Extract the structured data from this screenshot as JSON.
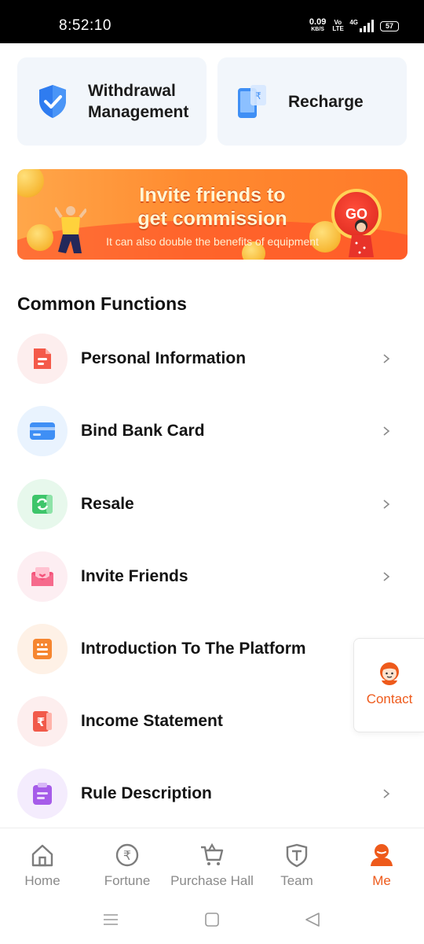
{
  "status_bar": {
    "time": "8:52:10",
    "speed_value": "0.09",
    "speed_unit": "KB/S",
    "volte": "Vo LTE",
    "network": "4G",
    "battery": "57"
  },
  "quick_actions": {
    "withdrawal_line1": "Withdrawal",
    "withdrawal_line2": "Management",
    "recharge": "Recharge"
  },
  "banner": {
    "title_line1": "Invite friends to",
    "title_line2": "get commission",
    "subtitle": "It can also double the benefits of equipment",
    "go_label": "GO"
  },
  "common_functions": {
    "title": "Common Functions",
    "items": [
      {
        "label": "Personal Information",
        "icon": "document-icon",
        "color": "#f45a4a",
        "bg": "#fdeeee"
      },
      {
        "label": "Bind Bank Card",
        "icon": "bank-card-icon",
        "color": "#3f8ff5",
        "bg": "#e9f3fe"
      },
      {
        "label": "Resale",
        "icon": "resale-icon",
        "color": "#3dc56a",
        "bg": "#e7f8ec"
      },
      {
        "label": "Invite Friends",
        "icon": "envelope-heart-icon",
        "color": "#f4537a",
        "bg": "#fdeef2"
      },
      {
        "label": "Introduction To The Platform",
        "icon": "list-doc-icon",
        "color": "#f68630",
        "bg": "#fef1e6"
      },
      {
        "label": "Income Statement",
        "icon": "rupee-doc-icon",
        "color": "#f15a4a",
        "bg": "#fdeeee"
      },
      {
        "label": "Rule Description",
        "icon": "clipboard-icon",
        "color": "#a65ce9",
        "bg": "#f4ecfd"
      }
    ]
  },
  "contact": {
    "label": "Contact"
  },
  "bottom_nav": {
    "items": [
      {
        "label": "Home",
        "icon": "home-icon"
      },
      {
        "label": "Fortune",
        "icon": "rupee-circle-icon"
      },
      {
        "label": "Purchase Hall",
        "icon": "cart-icon"
      },
      {
        "label": "Team",
        "icon": "team-icon"
      },
      {
        "label": "Me",
        "icon": "person-icon",
        "active": true
      }
    ]
  },
  "colors": {
    "accent": "#ee5a1b",
    "card_bg": "#f2f6fb",
    "inactive_nav": "#8a8a8a"
  }
}
